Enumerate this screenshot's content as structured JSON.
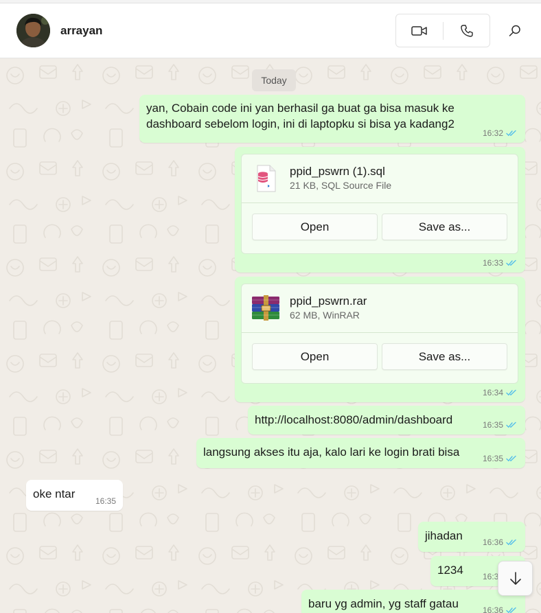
{
  "header": {
    "contact_name": "arrayan",
    "icons": {
      "video": "video-camera-icon",
      "voice": "phone-icon",
      "search": "search-icon"
    }
  },
  "chat": {
    "date_separator": "Today",
    "messages": [
      {
        "direction": "outgoing",
        "type": "text",
        "lines": [
          "yan, Cobain code ini yan berhasil ga buat ga bisa masuk ke",
          "dashboard sebelom login, ini di laptopku si bisa ya kadang2"
        ],
        "time": "16:32",
        "status": "read"
      },
      {
        "direction": "outgoing",
        "type": "file",
        "file_name": "ppid_pswrn (1).sql",
        "file_info": "21 KB, SQL Source File",
        "file_icon": "sql-file-icon",
        "open_label": "Open",
        "save_label": "Save as...",
        "time": "16:33",
        "status": "read"
      },
      {
        "direction": "outgoing",
        "type": "file",
        "file_name": "ppid_pswrn.rar",
        "file_info": "62 MB, WinRAR",
        "file_icon": "winrar-archive-icon",
        "open_label": "Open",
        "save_label": "Save as...",
        "time": "16:34",
        "status": "read"
      },
      {
        "direction": "outgoing",
        "type": "text",
        "text": "http://localhost:8080/admin/dashboard",
        "time": "16:35",
        "status": "read"
      },
      {
        "direction": "outgoing",
        "type": "text",
        "text": "langsung akses itu aja, kalo lari ke login brati bisa",
        "time": "16:35",
        "status": "read"
      },
      {
        "direction": "incoming",
        "type": "text",
        "text": "oke ntar",
        "time": "16:35"
      },
      {
        "direction": "outgoing",
        "type": "text",
        "text": "jihadan",
        "time": "16:36",
        "status": "read"
      },
      {
        "direction": "outgoing",
        "type": "text",
        "text": "1234",
        "time": "16:36",
        "status": "read"
      },
      {
        "direction": "outgoing",
        "type": "text",
        "text": "baru yg admin, yg staff gatau",
        "time": "16:36",
        "status": "read"
      }
    ]
  },
  "colors": {
    "outgoing_bubble": "#d9fdd3",
    "incoming_bubble": "#ffffff",
    "read_ticks": "#53bdeb",
    "chat_background": "#f1ede7"
  },
  "scroll_button": {
    "icon": "arrow-down-icon"
  }
}
